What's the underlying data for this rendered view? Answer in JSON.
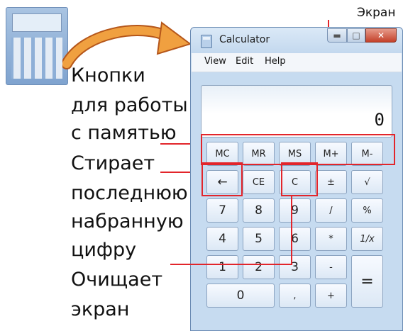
{
  "annotations": {
    "screen": "Экран",
    "memory": [
      "Кнопки",
      "для работы",
      "с памятью"
    ],
    "backspace": [
      "Стирает",
      "последнюю",
      "набранную",
      "цифру"
    ],
    "clear": [
      "Очищает",
      "экран"
    ]
  },
  "window": {
    "title": "Calculator",
    "controls": {
      "minimize": "▬",
      "maximize": "□",
      "close": "✕"
    }
  },
  "menu": [
    "View",
    "Edit",
    "Help"
  ],
  "display": {
    "value": "0"
  },
  "keys": {
    "memory": [
      "MC",
      "MR",
      "MS",
      "M+",
      "M-"
    ],
    "row1": [
      "←",
      "CE",
      "C",
      "±",
      "√"
    ],
    "row2": [
      "7",
      "8",
      "9",
      "/",
      "%"
    ],
    "row3": [
      "4",
      "5",
      "6",
      "*",
      "1/x"
    ],
    "row4": [
      "1",
      "2",
      "3",
      "-"
    ],
    "row5": [
      "0",
      ",",
      "+"
    ],
    "equals": "="
  },
  "colors": {
    "annotation_line": "#e2252b",
    "arrow": "#e88a2a"
  }
}
